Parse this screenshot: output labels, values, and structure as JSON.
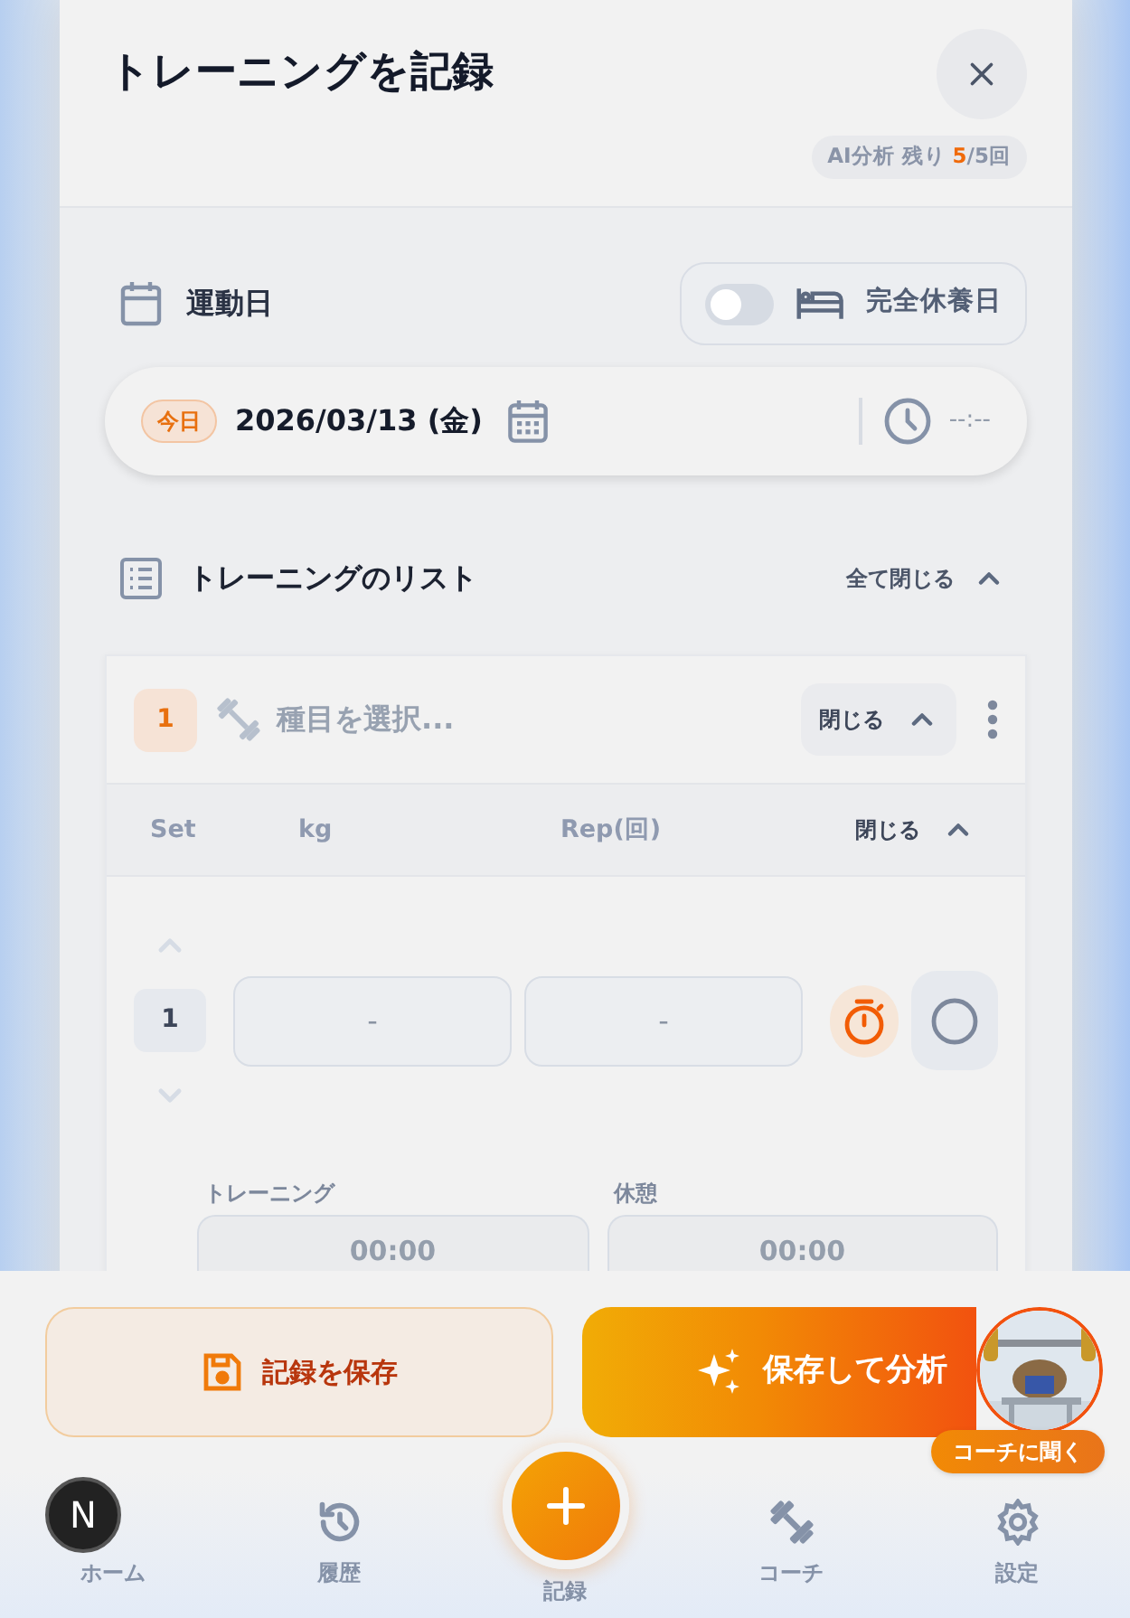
{
  "header": {
    "title": "トレーニングを記録",
    "quota": {
      "label": "AI分析 残り",
      "remaining": "5",
      "total": "/5回"
    }
  },
  "date_section": {
    "label": "運動日",
    "rest_day": {
      "label": "完全休養日",
      "on": false
    },
    "badge": "今日",
    "date": "2026/03/13 (金)",
    "time_placeholder": "--:--"
  },
  "list": {
    "title": "トレーニングのリスト",
    "collapse_all": "全て閉じる",
    "exercises": [
      {
        "number": "1",
        "placeholder": "種目を選択...",
        "collapse": "閉じる",
        "columns": [
          "Set",
          "kg",
          "Rep(回)"
        ],
        "sets_collapse": "閉じる",
        "sets": [
          {
            "number": "1",
            "kg_placeholder": "-",
            "rep_placeholder": "-",
            "done": false
          }
        ],
        "timers": [
          {
            "label": "トレーニング",
            "placeholder": "00:00"
          },
          {
            "label": "休憩",
            "placeholder": "00:00"
          }
        ]
      }
    ]
  },
  "actions": {
    "save": "記録を保存",
    "analyze": "保存して分析",
    "coach": "コーチに聞く"
  },
  "nav": [
    {
      "kind": "home",
      "label": "ホーム",
      "selected": false
    },
    {
      "kind": "history",
      "label": "履歴",
      "selected": false
    },
    {
      "kind": "add",
      "label": "記録",
      "selected": false
    },
    {
      "kind": "coach",
      "label": "コーチ",
      "selected": false
    },
    {
      "kind": "settings",
      "label": "設定",
      "selected": false
    }
  ],
  "dev_badge": "N"
}
